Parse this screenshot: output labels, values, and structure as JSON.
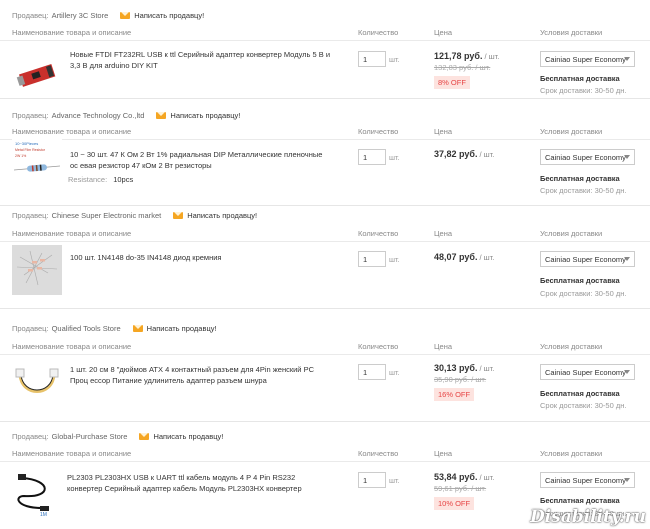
{
  "columns": {
    "product": "Наименование товара и описание",
    "quantity": "Количество",
    "price": "Цена",
    "shipping": "Условия доставки"
  },
  "labels": {
    "seller": "Продавец:",
    "message_seller": "Написать продавцу!",
    "unit": "шт.",
    "per_unit": "/ шт.",
    "free_shipping": "Бесплатная доставка",
    "delivery_term": "Срок доставки: 30-50 дн."
  },
  "orders": [
    {
      "seller": "Artillery 3C Store",
      "product_title": "Новые FTDI FT232RL USB к ttl Серийный адаптер конвертер Модуль 5 В и 3,3 В для arduino DIY KIT",
      "attribute_name": "",
      "attribute_value": "",
      "quantity": "1",
      "price": "121,78 руб.",
      "old_price": "132,83 руб. / шт.",
      "discount": "8% OFF",
      "shipping_method": "Cainiao Super Economy"
    },
    {
      "seller": "Advance Technology Co.,ltd",
      "product_title": "10 ~ 30 шт. 47 К Ом 2 Вт 1% радиальная DIP Металлические пленочные ос евая резистор 47 кОм 2 Вт резисторы",
      "attribute_name": "Resistance:",
      "attribute_value": "10pcs",
      "quantity": "1",
      "price": "37,82 руб.",
      "old_price": "",
      "discount": "",
      "shipping_method": "Cainiao Super Economy"
    },
    {
      "seller": "Chinese Super Electronic market",
      "product_title": "100 шт. 1N4148 do-35 IN4148 диод кремния",
      "attribute_name": "",
      "attribute_value": "",
      "quantity": "1",
      "price": "48,07 руб.",
      "old_price": "",
      "discount": "",
      "shipping_method": "Cainiao Super Economy"
    },
    {
      "seller": "Qualified Tools Store",
      "product_title": "1 шт. 20 см 8 \"дюймов ATX 4 контактный разъем для 4Pin женский PC Проц ессор Питание удлинитель адаптер разъем шнура",
      "attribute_name": "",
      "attribute_value": "",
      "quantity": "1",
      "price": "30,13 руб.",
      "old_price": "35,90 руб. / шт.",
      "discount": "16% OFF",
      "shipping_method": "Cainiao Super Economy"
    },
    {
      "seller": "Global-Purchase Store",
      "product_title": "PL2303 PL2303HX USB к UART ttl кабель модуль 4 P 4 Pin RS232 конвертер Серийный адаптер кабель Модуль PL2303HX конвертер",
      "attribute_name": "",
      "attribute_value": "",
      "quantity": "1",
      "price": "53,84 руб.",
      "old_price": "59,61 руб. / шт.",
      "discount": "10% OFF",
      "shipping_method": "Cainiao Super Economy"
    }
  ],
  "watermark": "Disability.ru",
  "colors": {
    "discount_text": "#e64545",
    "discount_bg": "#fde3df",
    "mail_icon": "#f5a623",
    "separator": "#e6e6e6"
  }
}
